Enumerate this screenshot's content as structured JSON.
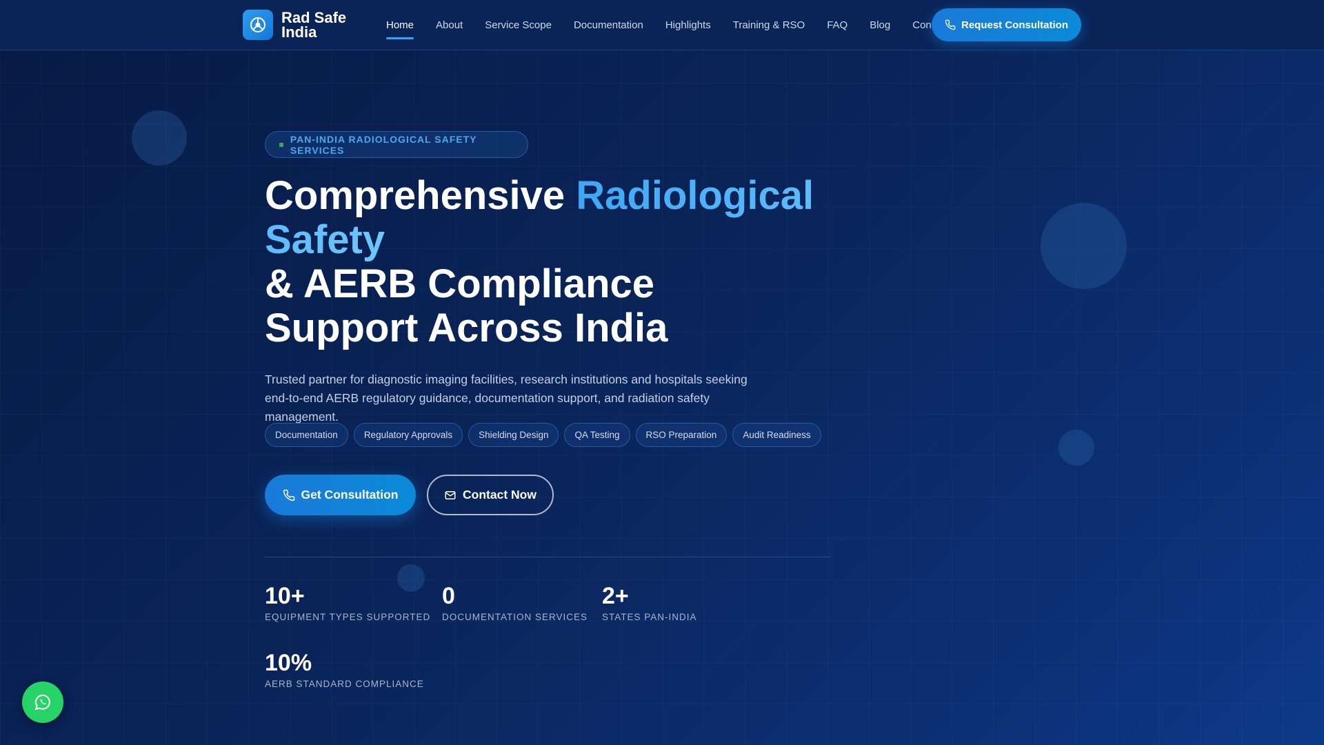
{
  "brand": {
    "name": "Rad Safe India"
  },
  "nav": {
    "links": [
      "Home",
      "About",
      "Service Scope",
      "Documentation",
      "Highlights",
      "Training & RSO",
      "FAQ",
      "Blog",
      "Contact"
    ],
    "active": "Home",
    "cta": "Request Consultation"
  },
  "hero": {
    "badge": "PAN-INDIA RADIOLOGICAL SAFETY SERVICES",
    "title_part1": "Comprehensive ",
    "title_highlight": "Radiological Safety",
    "title_part2": "& AERB Compliance Support Across India",
    "description": "Trusted partner for diagnostic imaging facilities, research institutions and hospitals seeking end-to-end AERB regulatory guidance, documentation support, and radiation safety management.",
    "chips": [
      "Documentation",
      "Regulatory Approvals",
      "Shielding Design",
      "QA Testing",
      "RSO Preparation",
      "Audit Readiness"
    ],
    "primary_button": "Get Consultation",
    "secondary_button": "Contact Now"
  },
  "stats": [
    {
      "value": "10+",
      "label": "EQUIPMENT TYPES SUPPORTED"
    },
    {
      "value": "0",
      "label": "DOCUMENTATION SERVICES"
    },
    {
      "value": "2+",
      "label": "STATES PAN-INDIA"
    },
    {
      "value": "10%",
      "label": "AERB STANDARD COMPLIANCE"
    }
  ],
  "colors": {
    "accent": "#1a7ad9",
    "highlight": "#3ea6f6",
    "whatsapp": "#25d366",
    "background": "#0a2458"
  }
}
